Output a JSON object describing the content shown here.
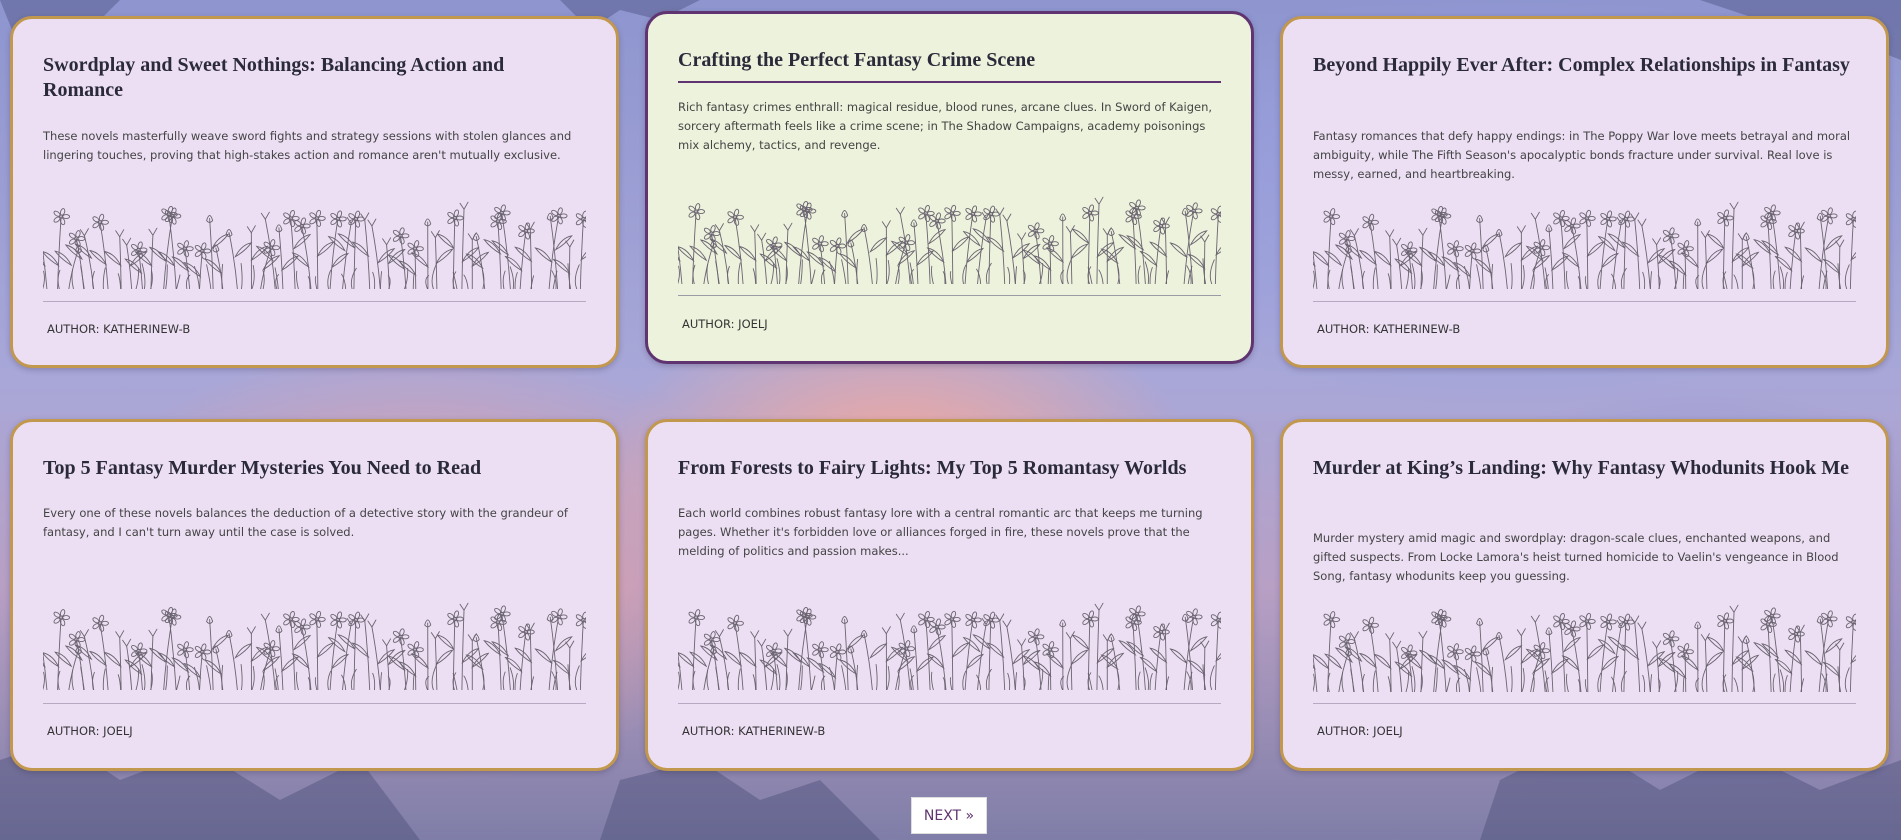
{
  "posts": [
    {
      "title": "Swordplay and Sweet Nothings: Balancing Action and Romance",
      "excerpt": "These novels masterfully weave sword fights and strategy sessions with stolen glances and lingering touches, proving that high-stakes action and romance aren't mutually exclusive.",
      "author": "AUTHOR: KATHERINEW-B"
    },
    {
      "title": "Crafting the Perfect Fantasy Crime Scene",
      "excerpt": "Rich fantasy crimes enthrall: magical residue, blood runes, arcane clues. In Sword of Kaigen, sorcery aftermath feels like a crime scene; in The Shadow Campaigns, academy poisonings mix alchemy, tactics, and revenge.",
      "author": "AUTHOR: JOELJ"
    },
    {
      "title": "Beyond Happily Ever After: Complex Relationships in Fantasy",
      "excerpt": "Fantasy romances that defy happy endings: in The Poppy War love meets betrayal and moral ambiguity, while The Fifth Season's apocalyptic bonds fracture under survival. Real love is messy, earned, and heartbreaking.",
      "author": "AUTHOR: KATHERINEW-B"
    },
    {
      "title": "Top 5 Fantasy Murder Mysteries You Need to Read",
      "excerpt": "Every one of these novels balances the deduction of a detective story with the grandeur of fantasy, and I can't turn away until the case is solved.",
      "author": "AUTHOR: JOELJ"
    },
    {
      "title": "From Forests to Fairy Lights: My Top 5 Romantasy Worlds",
      "excerpt": "Each world combines robust fantasy lore with a central romantic arc that keeps me turning pages. Whether it's forbidden love or alliances forged in fire, these novels prove that the melding of politics and passion makes...",
      "author": "AUTHOR: KATHERINEW-B"
    },
    {
      "title": "Murder at King’s Landing: Why Fantasy Whodunits Hook Me",
      "excerpt": "Murder mystery amid magic and swordplay: dragon-scale clues, enchanted weapons, and gifted suspects. From Locke Lamora's heist turned homicide to Vaelin's vengeance in Blood Song, fantasy whodunits keep you guessing.",
      "author": "AUTHOR: JOELJ"
    }
  ],
  "pagination": {
    "next_label": "NEXT »"
  },
  "colors": {
    "card_bg": "#ecdff4",
    "card_border": "#c2974e",
    "active_card_bg": "#ecf2dc",
    "active_card_border": "#5f3470",
    "accent": "#5f3470"
  }
}
